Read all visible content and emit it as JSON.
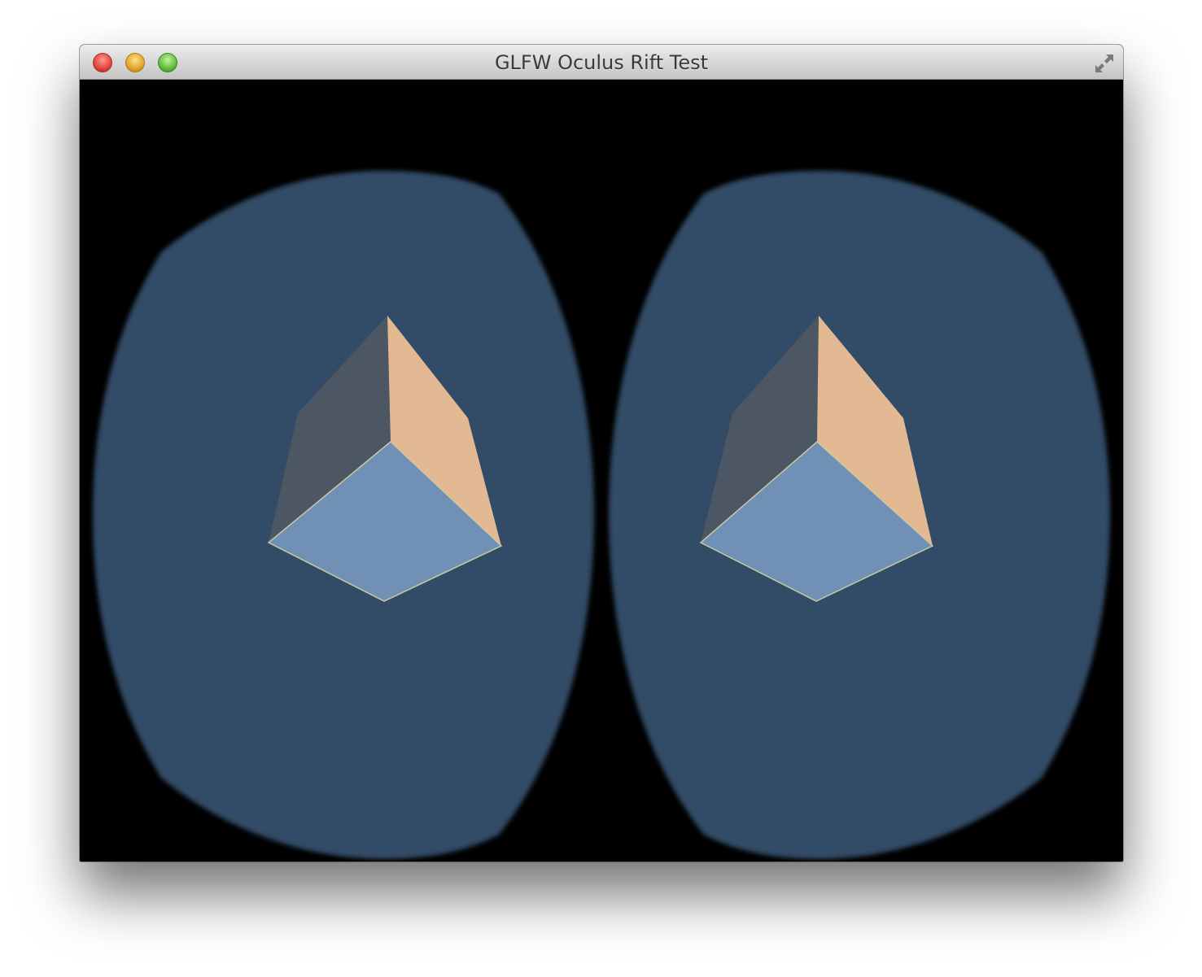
{
  "window": {
    "title": "GLFW Oculus Rift Test",
    "buttons": {
      "close": "close-icon",
      "minimize": "minimize-icon",
      "zoom": "zoom-icon",
      "fullscreen": "fullscreen-icon"
    }
  },
  "scene": {
    "background_color": "#000000",
    "lens_color": "#334c66",
    "cube_colors": {
      "top_face": "#e2b992",
      "left_face": "#4d5663",
      "bottom_face": "#7091b5",
      "edge": "#c9c9a0"
    }
  }
}
